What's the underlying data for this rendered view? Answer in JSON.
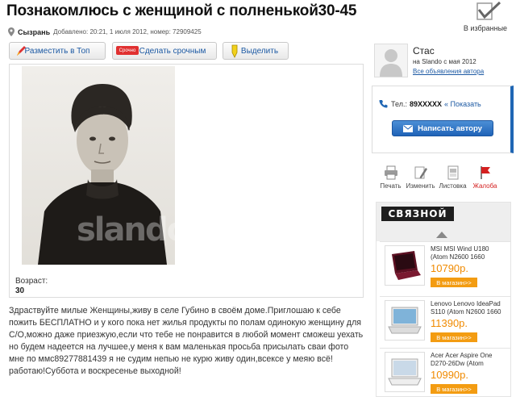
{
  "title": "Познакомлюсь с женщиной с полненькой30-45",
  "favorites": {
    "label": "В избранные",
    "icon": "checkmark-icon"
  },
  "meta": {
    "city": "Сызрань",
    "added_text": "Добавлено: 20:21, 1 июля 2012, номер: 72909425"
  },
  "buttons": {
    "top": "Разместить в Топ",
    "urgent": "Сделать срочным",
    "urgent_tag": "Срочно",
    "highlight": "Выделить"
  },
  "listing": {
    "photo_watermark": "slando",
    "age_label": "Возраст:",
    "age_value": "30",
    "description": "Здраствуйте милые Женщины,живу в селе Губино в своём доме.Приглошаю к себе пожить БЕСПЛАТНО и у кого пока нет жилья продукты по полам одинокую женщину для С/О,можно даже приезжую,если что тебе не понравится в любой момент сможеш уехать но будем надеется на лучшее,у меня к вам маленькая просьба присылать сваи фото мне по ммс89277881439 я не судим непью не курю живу один,всексе у меяю всё!работаю!Суббота и воскресенье выходной!"
  },
  "seller": {
    "name": "Стас",
    "since": "на Slando с мая 2012",
    "all_ads_link": "Все объявления автора"
  },
  "contact": {
    "phone_label": "Тел.:",
    "phone_number": "89XXXXX",
    "show_label": "« Показать",
    "write_button": "Написать автору"
  },
  "actions": [
    {
      "label": "Печать",
      "icon": "printer-icon"
    },
    {
      "label": "Изменить",
      "icon": "pencil-icon"
    },
    {
      "label": "Листовка",
      "icon": "flyer-icon"
    },
    {
      "label": "Жалоба",
      "icon": "flag-icon"
    }
  ],
  "ad": {
    "brand": "СВЯЗНОЙ",
    "products": [
      {
        "name": "MSI MSI Wind U180 (Atom N2600 1660",
        "price": "10790р.",
        "button": "В магазин>>"
      },
      {
        "name": "Lenovo Lenovo IdeaPad S110 (Atom N2600 1660",
        "price": "11390р.",
        "button": "В магазин>>"
      },
      {
        "name": "Acer Acer Aspire One D270-26Dw (Atom",
        "price": "10990р.",
        "button": "В магазин>>"
      }
    ]
  },
  "colors": {
    "accent_blue": "#1f66b4",
    "link_blue": "#1c59a3",
    "price_orange": "#f08a00",
    "report_red": "#d42020"
  }
}
